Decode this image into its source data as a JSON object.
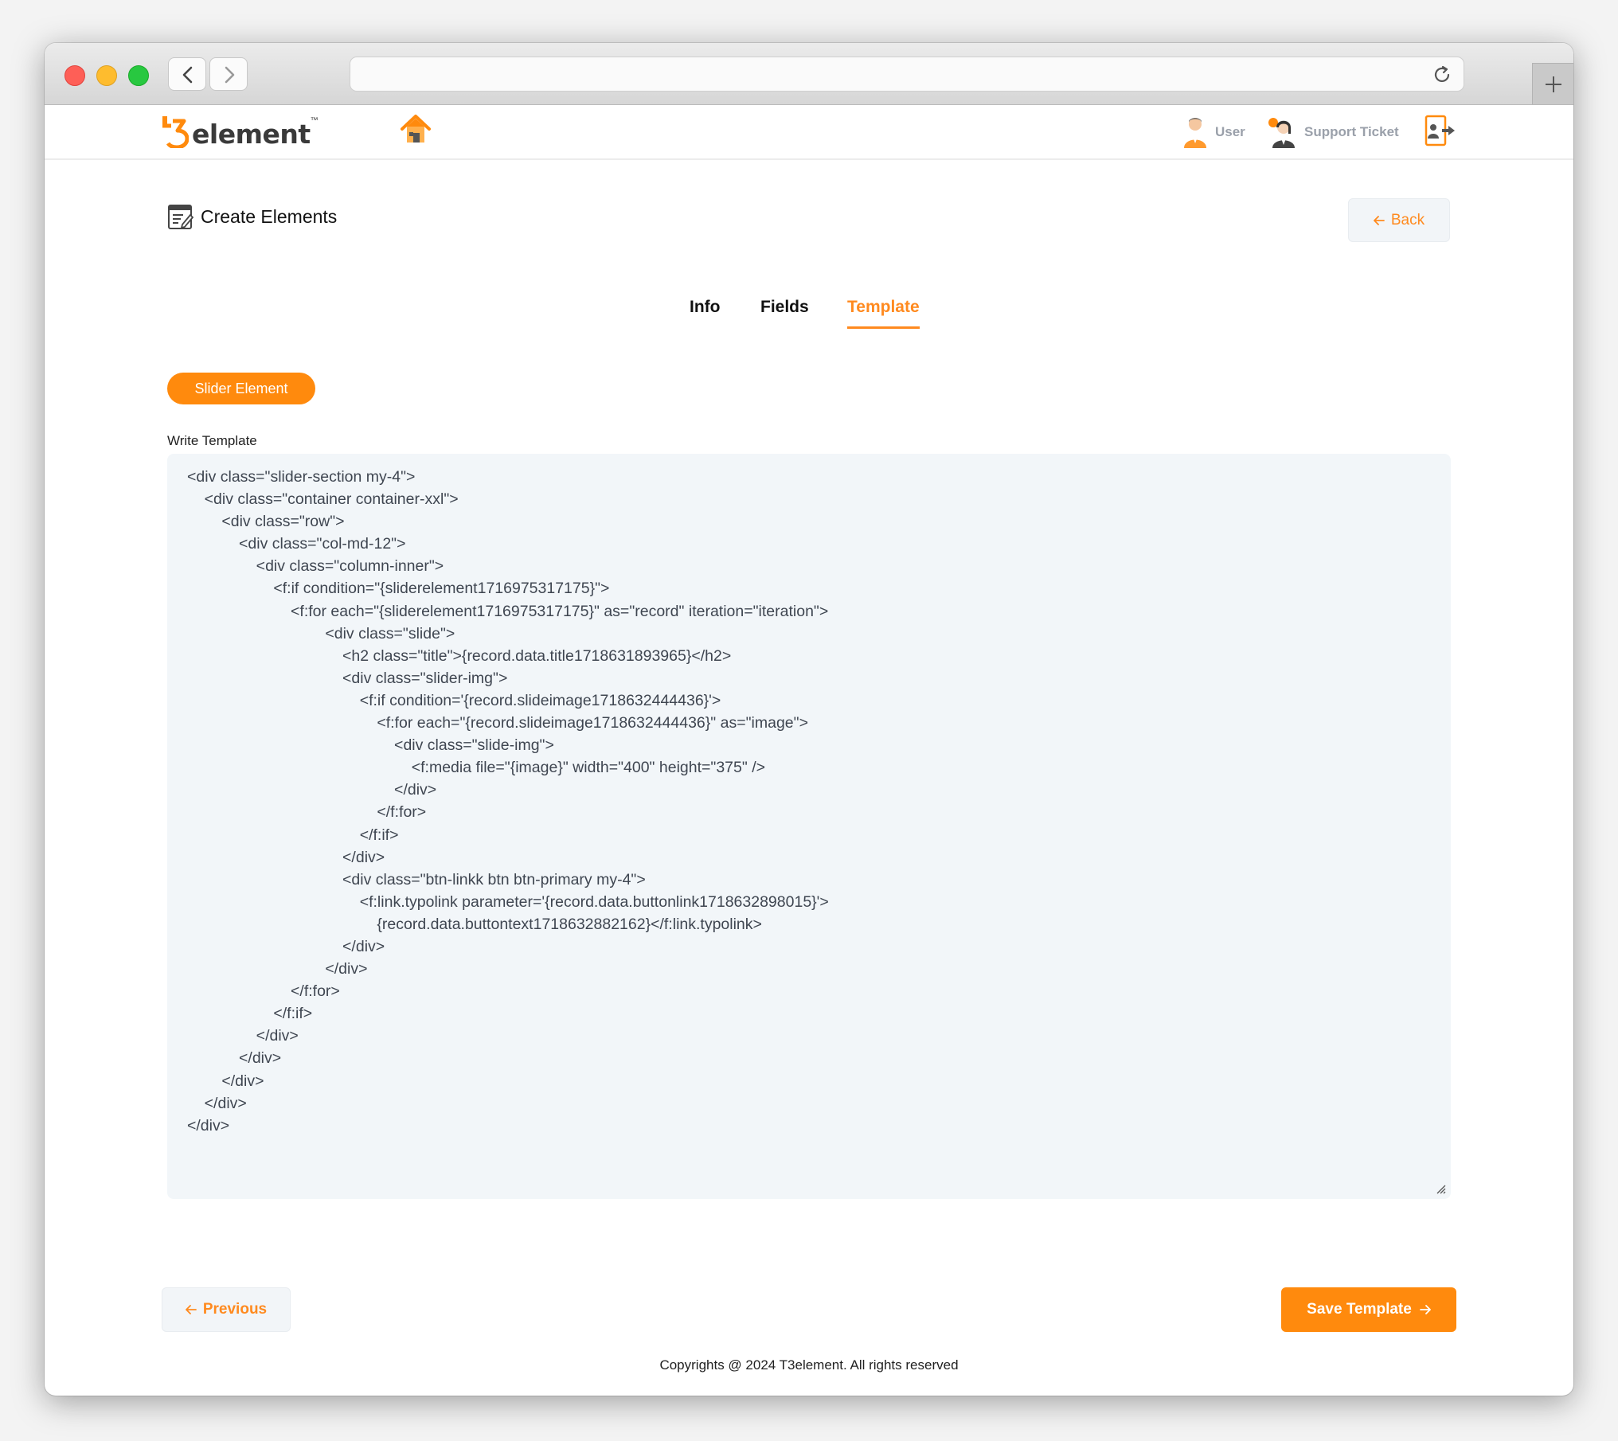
{
  "header": {
    "brand_text": "element",
    "brand_tm": "™",
    "user_label": "User",
    "support_label": "Support Ticket"
  },
  "page": {
    "title": "Create Elements",
    "back_label": "Back"
  },
  "tabs": [
    {
      "label": "Info",
      "active": false
    },
    {
      "label": "Fields",
      "active": false
    },
    {
      "label": "Template",
      "active": true
    }
  ],
  "element_chip": "Slider Element",
  "editor": {
    "label": "Write Template",
    "lines": [
      "<div class=\"slider-section my-4\">",
      "    <div class=\"container container-xxl\">",
      "        <div class=\"row\">",
      "            <div class=\"col-md-12\">",
      "                <div class=\"column-inner\">",
      "                    <f:if condition=\"{sliderelement1716975317175}\">",
      "                        <f:for each=\"{sliderelement1716975317175}\" as=\"record\" iteration=\"iteration\">",
      "                                <div class=\"slide\">",
      "                                    <h2 class=\"title\">{record.data.title1718631893965}</h2>",
      "                                    <div class=\"slider-img\">",
      "                                        <f:if condition='{record.slideimage1718632444436}'>",
      "                                            <f:for each=\"{record.slideimage1718632444436}\" as=\"image\">",
      "                                                <div class=\"slide-img\">",
      "                                                    <f:media file=\"{image}\" width=\"400\" height=\"375\" />",
      "                                                </div>",
      "                                            </f:for>",
      "                                        </f:if>",
      "                                    </div>",
      "                                    <div class=\"btn-linkk btn btn-primary my-4\">",
      "                                        <f:link.typolink parameter='{record.data.buttonlink1718632898015}'>",
      "                                            {record.data.buttontext1718632882162}</f:link.typolink>",
      "                                    </div>",
      "                                </div>",
      "                        </f:for>",
      "                    </f:if>",
      "                </div>",
      "            </div>",
      "        </div>",
      "    </div>",
      "</div>"
    ]
  },
  "footer": {
    "previous_label": "Previous",
    "save_label": "Save Template",
    "copyright": "Copyrights @ 2024 T3element. All rights reserved"
  },
  "colors": {
    "accent": "#ff8a0d",
    "editor_bg": "#f2f6f9",
    "muted_text": "#9aa0aa"
  }
}
